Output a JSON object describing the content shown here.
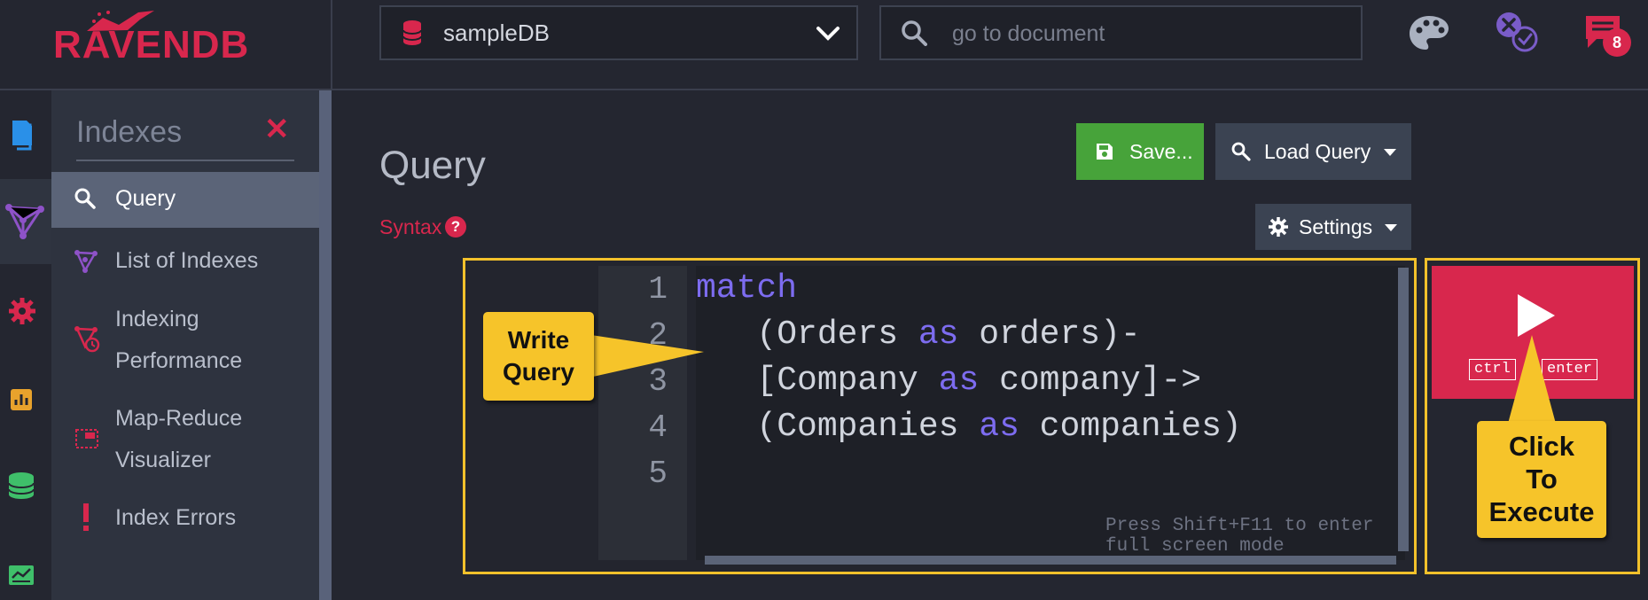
{
  "app": {
    "logo_text": "RAVENDB"
  },
  "header": {
    "database": "sampleDB",
    "search_placeholder": "go to document",
    "notifications_count": "8"
  },
  "submenu": {
    "title": "Indexes",
    "items": [
      {
        "label": "Query",
        "icon": "search-icon",
        "active": true
      },
      {
        "label": "List of Indexes",
        "icon": "index-icon"
      },
      {
        "label": "Indexing",
        "label2": "Performance",
        "icon": "performance-icon"
      },
      {
        "label": "Map-Reduce",
        "label2": "Visualizer",
        "icon": "map-reduce-icon"
      },
      {
        "label": "Index Errors",
        "icon": "exclamation-icon"
      }
    ]
  },
  "main": {
    "title": "Query",
    "syntax_label": "Syntax",
    "syntax_help": "?",
    "save_label": "Save...",
    "load_label": "Load Query",
    "settings_label": "Settings",
    "editor": {
      "line_numbers": [
        "1",
        "2",
        "3",
        "4",
        "5"
      ],
      "fullscreen_hint": "Press Shift+F11 to enter full screen mode"
    },
    "run": {
      "ctrl": "ctrl",
      "enter": "enter"
    }
  },
  "callouts": {
    "write_line1": "Write",
    "write_line2": "Query",
    "click_line1": "Click",
    "click_line2": "To",
    "click_line3": "Execute"
  },
  "colors": {
    "brand": "#d8274d",
    "highlight_frame": "#f3c12b",
    "save_green": "#47a33a",
    "keyword": "#7d6cf0"
  }
}
